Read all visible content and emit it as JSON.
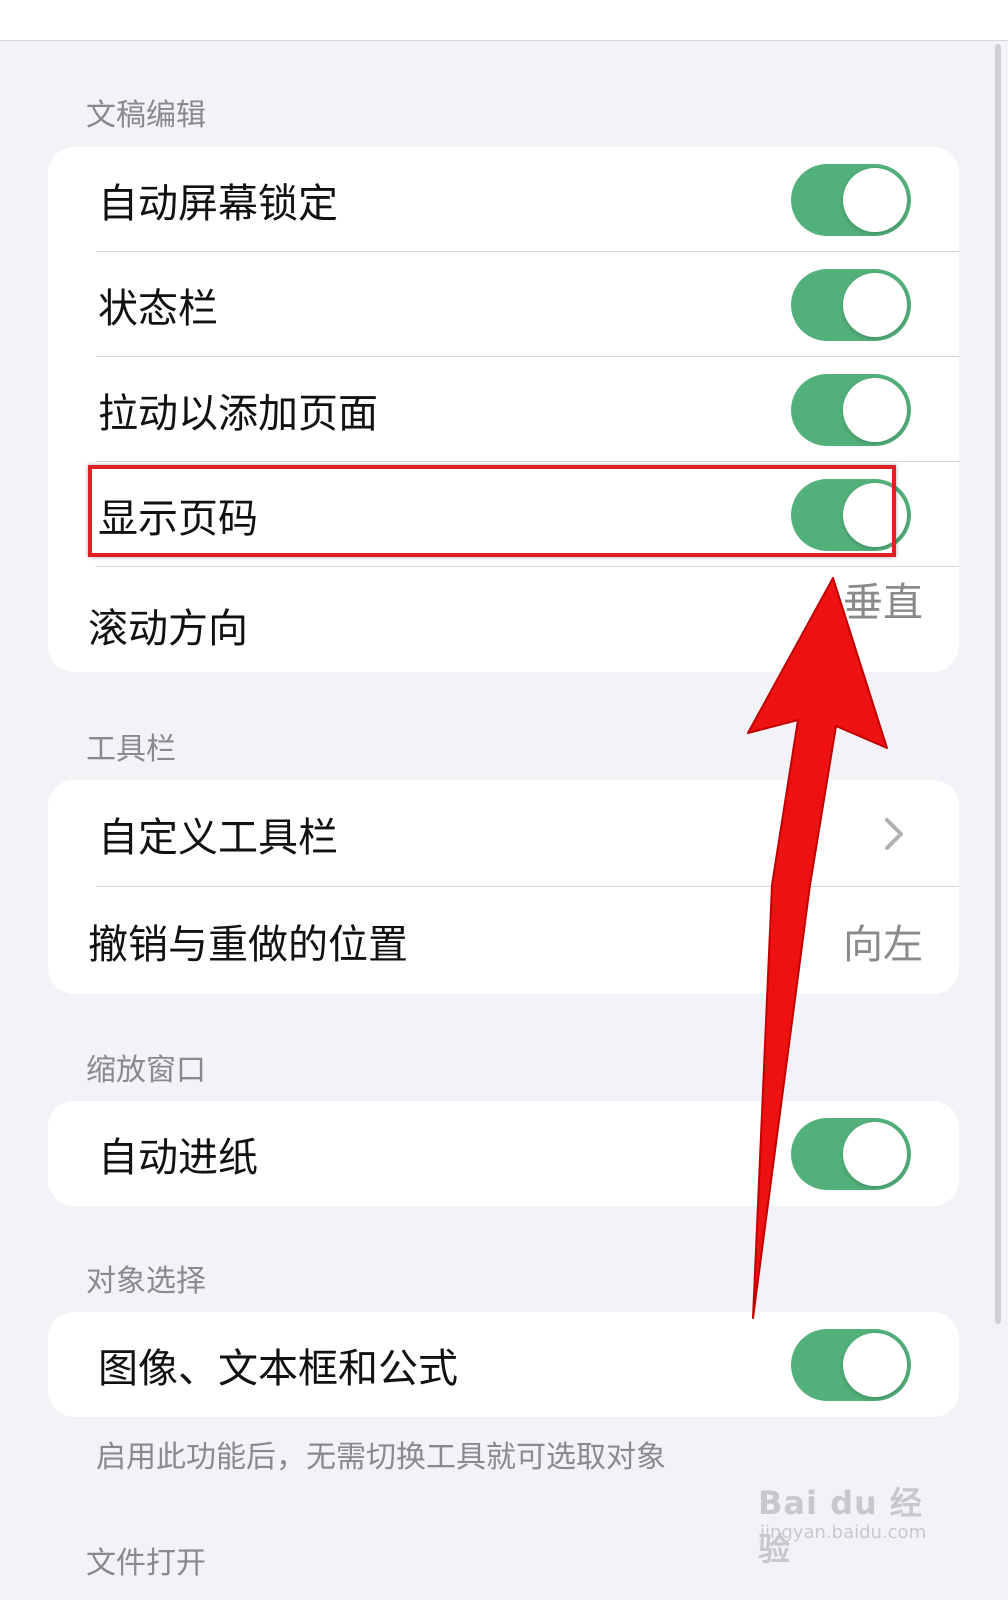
{
  "sections": {
    "draft_editing": {
      "header": "文稿编辑",
      "rows": [
        {
          "label": "自动屏幕锁定",
          "toggle": true
        },
        {
          "label": "状态栏",
          "toggle": true
        },
        {
          "label": "拉动以添加页面",
          "toggle": true
        },
        {
          "label": "显示页码",
          "toggle": true
        },
        {
          "label": "滚动方向",
          "value": "垂直"
        }
      ]
    },
    "toolbar": {
      "header": "工具栏",
      "rows": [
        {
          "label": "自定义工具栏"
        },
        {
          "label": "撤销与重做的位置",
          "value": "向左"
        }
      ]
    },
    "zoom_window": {
      "header": "缩放窗口",
      "rows": [
        {
          "label": "自动进纸",
          "toggle": true
        }
      ]
    },
    "object_selection": {
      "header": "对象选择",
      "rows": [
        {
          "label": "图像、文本框和公式",
          "toggle": true
        }
      ],
      "footer": "启用此功能后，无需切换工具就可选取对象"
    },
    "file_open": {
      "header": "文件打开"
    }
  },
  "watermark": {
    "brand": "Bai du 经验",
    "url": "jingyan.baidu.com"
  },
  "colors": {
    "toggle_on": "#52b07a",
    "annotation_red": "#e01f26",
    "background": "#f2f2f7"
  }
}
